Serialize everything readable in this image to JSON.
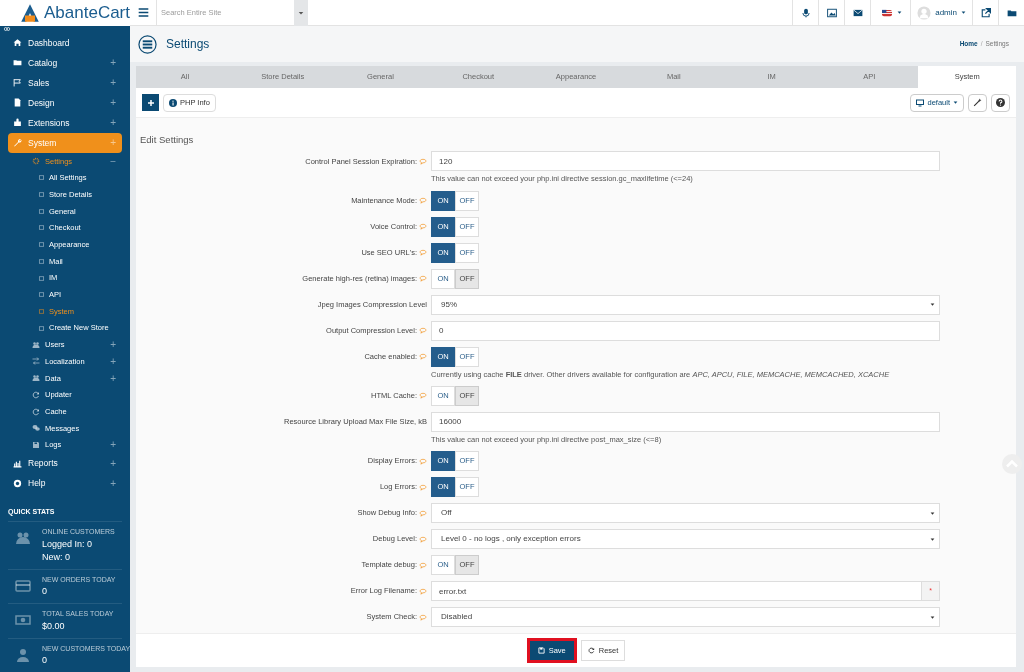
{
  "logo": {
    "text": "AbanteCart"
  },
  "topbar": {
    "search_placeholder": "Search Entire Site",
    "user": "admin"
  },
  "sidebar": {
    "items": [
      {
        "label": "Dashboard",
        "selected": false
      },
      {
        "label": "Catalog",
        "toggle": "+",
        "selected": false
      },
      {
        "label": "Sales",
        "toggle": "+",
        "selected": false
      },
      {
        "label": "Design",
        "toggle": "+",
        "selected": false
      },
      {
        "label": "Extensions",
        "toggle": "+",
        "selected": false
      },
      {
        "label": "System",
        "toggle": "+",
        "selected": true,
        "children": [
          {
            "label": "Settings",
            "toggle": "−",
            "selected": true,
            "children": [
              {
                "label": "All Settings",
                "selected": false
              },
              {
                "label": "Store Details",
                "selected": false
              },
              {
                "label": "General",
                "selected": false
              },
              {
                "label": "Checkout",
                "selected": false
              },
              {
                "label": "Appearance",
                "selected": false
              },
              {
                "label": "Mail",
                "selected": false
              },
              {
                "label": "IM",
                "selected": false
              },
              {
                "label": "API",
                "selected": false
              },
              {
                "label": "System",
                "selected": true
              },
              {
                "label": "Create New Store",
                "selected": false
              }
            ]
          },
          {
            "label": "Users",
            "toggle": "+",
            "selected": false
          },
          {
            "label": "Localization",
            "toggle": "+",
            "selected": false
          },
          {
            "label": "Data",
            "toggle": "+",
            "selected": false
          },
          {
            "label": "Updater",
            "selected": false
          },
          {
            "label": "Cache",
            "selected": false
          },
          {
            "label": "Messages",
            "selected": false
          },
          {
            "label": "Logs",
            "toggle": "+",
            "selected": false
          }
        ]
      },
      {
        "label": "Reports",
        "toggle": "+",
        "selected": false
      },
      {
        "label": "Help",
        "toggle": "+",
        "selected": false
      }
    ],
    "quick_stats": {
      "title": "QUICK STATS",
      "items": [
        {
          "label": "ONLINE CUSTOMERS",
          "values": [
            "Logged In: 0",
            "New: 0"
          ]
        },
        {
          "label": "NEW ORDERS TODAY",
          "values": [
            "0"
          ]
        },
        {
          "label": "TOTAL SALES TODAY",
          "values": [
            "$0.00"
          ]
        },
        {
          "label": "NEW CUSTOMERS TODAY",
          "values": [
            "0"
          ]
        }
      ]
    }
  },
  "page": {
    "title": "Settings",
    "breadcrumb": [
      "Home",
      "Settings"
    ],
    "breadcrumb_separator": "/"
  },
  "tabs": [
    {
      "label": "All",
      "selected": false
    },
    {
      "label": "Store Details",
      "selected": false
    },
    {
      "label": "General",
      "selected": false
    },
    {
      "label": "Checkout",
      "selected": false
    },
    {
      "label": "Appearance",
      "selected": false
    },
    {
      "label": "Mail",
      "selected": false
    },
    {
      "label": "IM",
      "selected": false
    },
    {
      "label": "API",
      "selected": false
    },
    {
      "label": "System",
      "selected": true
    }
  ],
  "toolbar": {
    "info_button": "PHP Info",
    "template_select": "default"
  },
  "form": {
    "title": "Edit Settings",
    "fields": [
      {
        "kind": "text",
        "label": "Control Panel Session Expiration:",
        "tooltip": true,
        "value": "120",
        "help": "This value can not exceed your php.ini directive session.gc_maxlifetime (<=24)"
      },
      {
        "kind": "toggle",
        "label": "Maintenance Mode:",
        "tooltip": true,
        "on": true,
        "on_label": "ON",
        "off_label": "OFF"
      },
      {
        "kind": "toggle",
        "label": "Voice Control:",
        "tooltip": true,
        "on": true,
        "on_label": "ON",
        "off_label": "OFF"
      },
      {
        "kind": "toggle",
        "label": "Use SEO URL's:",
        "tooltip": true,
        "on": true,
        "on_label": "ON",
        "off_label": "OFF"
      },
      {
        "kind": "toggle",
        "label": "Generate high-res (retina) images:",
        "tooltip": true,
        "on": false,
        "on_label": "ON",
        "off_label": "OFF"
      },
      {
        "kind": "select",
        "label": "Jpeg Images Compression Level",
        "tooltip": false,
        "value": "95%"
      },
      {
        "kind": "text",
        "label": "Output Compression Level:",
        "tooltip": true,
        "value": "0"
      },
      {
        "kind": "toggle",
        "label": "Cache enabled:",
        "tooltip": true,
        "on": true,
        "on_label": "ON",
        "off_label": "OFF",
        "help": "Currently using cache **FILE** driver. Other drivers available for configuration are *APC, APCU, FILE, MEMCACHE, MEMCACHED, XCACHE*"
      },
      {
        "kind": "toggle",
        "label": "HTML Cache:",
        "tooltip": true,
        "on": false,
        "on_label": "ON",
        "off_label": "OFF"
      },
      {
        "kind": "text",
        "label": "Resource Library Upload Max File Size, kB",
        "tooltip": false,
        "value": "16000",
        "help": "This value can not exceed your php.ini directive post_max_size (<=8)"
      },
      {
        "kind": "toggle",
        "label": "Display Errors:",
        "tooltip": true,
        "on": true,
        "on_label": "ON",
        "off_label": "OFF"
      },
      {
        "kind": "toggle",
        "label": "Log Errors:",
        "tooltip": true,
        "on": true,
        "on_label": "ON",
        "off_label": "OFF"
      },
      {
        "kind": "select",
        "label": "Show Debug Info:",
        "tooltip": true,
        "value": "Off"
      },
      {
        "kind": "select",
        "label": "Debug Level:",
        "tooltip": true,
        "value": "Level 0 - no logs , only exception errors"
      },
      {
        "kind": "toggle",
        "label": "Template debug:",
        "tooltip": true,
        "on": false,
        "on_label": "ON",
        "off_label": "OFF"
      },
      {
        "kind": "required",
        "label": "Error Log Filename:",
        "tooltip": true,
        "value": "error.txt",
        "mark": "*"
      },
      {
        "kind": "select",
        "label": "System Check:",
        "tooltip": true,
        "value": "Disabled"
      }
    ]
  },
  "footer": {
    "buttons": [
      {
        "kind": "save",
        "label": "Save",
        "highlighted": true
      },
      {
        "kind": "reset",
        "label": "Reset",
        "highlighted": false
      }
    ]
  }
}
